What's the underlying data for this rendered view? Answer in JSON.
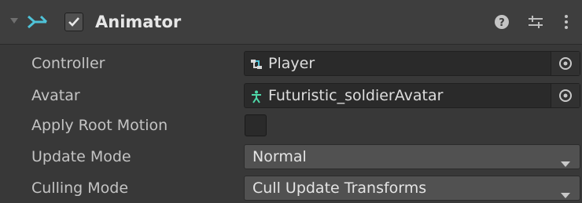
{
  "component": {
    "title": "Animator",
    "enabled": true,
    "icons": [
      "foldout-arrow-icon",
      "animator-component-icon",
      "help-icon",
      "presets-icon",
      "more-options-icon"
    ]
  },
  "fields": {
    "controller": {
      "label": "Controller",
      "value": "Player",
      "icon": "animator-controller-icon"
    },
    "avatar": {
      "label": "Avatar",
      "value": "Futuristic_soldierAvatar",
      "icon": "avatar-icon"
    },
    "apply_root_motion": {
      "label": "Apply Root Motion",
      "checked": false
    },
    "update_mode": {
      "label": "Update Mode",
      "value": "Normal"
    },
    "culling_mode": {
      "label": "Culling Mode",
      "value": "Cull Update Transforms"
    }
  },
  "colors": {
    "background": "#383838",
    "header": "#3e3e3e",
    "accent_icon": "#4fc3d8"
  }
}
